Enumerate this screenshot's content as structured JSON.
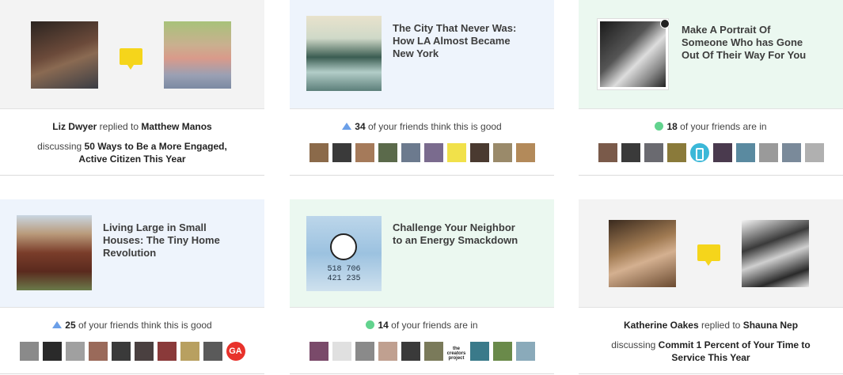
{
  "cards": [
    {
      "type": "reply",
      "replier": "Liz Dwyer",
      "replied_to": " replied to ",
      "target": "Matthew Manos",
      "discussing": "discussing ",
      "topic": "50 Ways to Be a More Engaged, Active Citizen This Year"
    },
    {
      "type": "article",
      "title": "The City That Never Was: How LA Almost Became New York",
      "count": "34",
      "status": " of your friends think this is good"
    },
    {
      "type": "article",
      "title": "Make A Portrait Of Someone Who has Gone Out Of Their Way For You",
      "count": "18",
      "status": " of your friends are in"
    },
    {
      "type": "article",
      "title": "Living Large in Small Houses: The Tiny Home Revolution",
      "count": "25",
      "status": " of your friends think this is good"
    },
    {
      "type": "article",
      "title": "Challenge Your Neighbor to an Energy Smackdown",
      "count": "14",
      "status": " of your friends are in",
      "thumb_text": [
        "518 706",
        "421 235"
      ]
    },
    {
      "type": "reply",
      "replier": "Katherine Oakes",
      "replied_to": " replied to ",
      "target": "Shauna Nep",
      "discussing": "discussing ",
      "topic": "Commit 1 Percent of Your Time to Service This Year"
    }
  ],
  "badges": {
    "ga": "GA",
    "creators": "the creators project"
  },
  "colors": {
    "bubble": "#f5d51b",
    "good_triangle": "#6b9fe8",
    "in_dot": "#62d38e",
    "panel_grey": "#f3f3f3",
    "panel_blue": "#eef4fc",
    "panel_green": "#ebf8f0"
  }
}
